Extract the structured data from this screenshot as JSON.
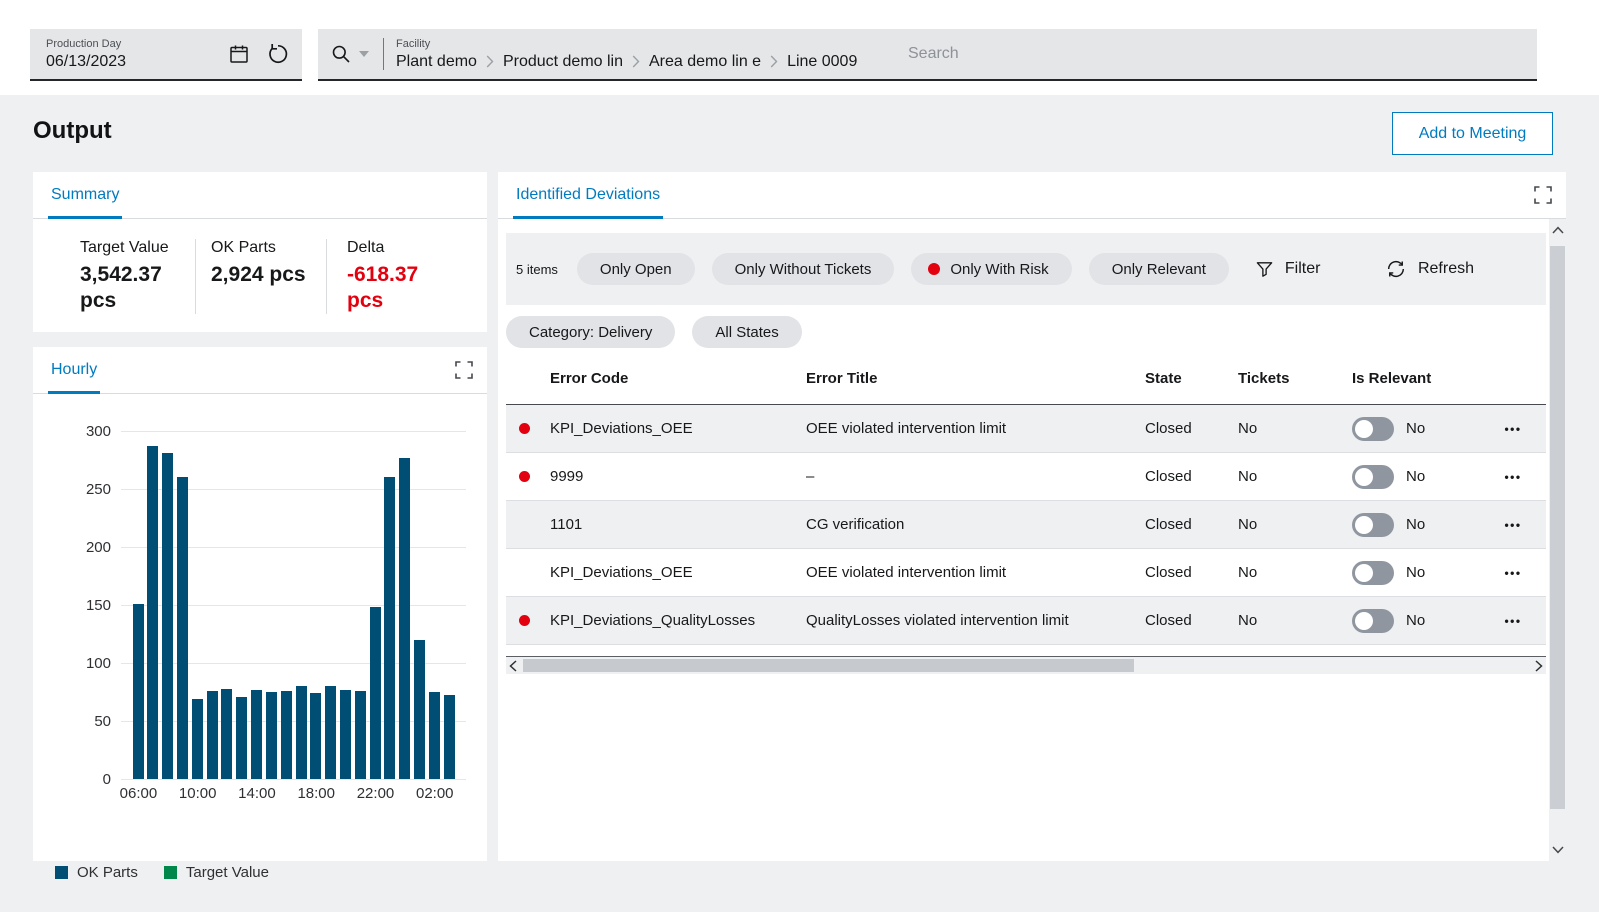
{
  "colors": {
    "accent_blue": "#007bc0",
    "bar_blue": "#004e73",
    "target_green": "#00884a",
    "alert_red": "#e3000f"
  },
  "topbar": {
    "production_day": {
      "label": "Production Day",
      "value": "06/13/2023"
    },
    "facility": {
      "label": "Facility",
      "breadcrumb": [
        "Plant demo",
        "Product demo lin",
        "Area demo lin e",
        "Line 0009"
      ],
      "search_placeholder": "Search"
    }
  },
  "page": {
    "title": "Output",
    "add_to_meeting_label": "Add to Meeting"
  },
  "summary": {
    "tab_label": "Summary",
    "stats": [
      {
        "label": "Target Value",
        "value": "3,542.37 pcs",
        "color": "dark"
      },
      {
        "label": "OK Parts",
        "value": "2,924 pcs",
        "color": "dark"
      },
      {
        "label": "Delta",
        "value": "-618.37 pcs",
        "color": "red"
      }
    ]
  },
  "hourly": {
    "tab_label": "Hourly",
    "legend": [
      {
        "label": "OK Parts",
        "color": "#004e73"
      },
      {
        "label": "Target Value",
        "color": "#00884a"
      }
    ]
  },
  "chart_data": {
    "type": "bar",
    "title": "Hourly",
    "x": [
      "06:00",
      "07:00",
      "08:00",
      "09:00",
      "10:00",
      "11:00",
      "12:00",
      "13:00",
      "14:00",
      "15:00",
      "16:00",
      "17:00",
      "18:00",
      "19:00",
      "20:00",
      "21:00",
      "22:00",
      "23:00",
      "00:00",
      "01:00",
      "02:00",
      "03:00"
    ],
    "series": [
      {
        "name": "OK Parts",
        "color": "#004e73",
        "values": [
          151,
          287,
          281,
          260,
          69,
          76,
          78,
          71,
          77,
          75,
          76,
          80,
          74,
          80,
          77,
          76,
          148,
          260,
          277,
          120,
          75,
          72
        ]
      },
      {
        "name": "Target Value",
        "color": "#00884a",
        "values": []
      }
    ],
    "ylim": [
      0,
      300
    ],
    "ytick_step": 50,
    "xticks_shown": [
      "06:00",
      "10:00",
      "14:00",
      "18:00",
      "22:00",
      "02:00"
    ],
    "grid": "horizontal",
    "legend_position": "bottom"
  },
  "deviations": {
    "tab_label": "Identified Deviations",
    "items_count": "5 items",
    "quick_filters": [
      {
        "label": "Only Open",
        "dot": false
      },
      {
        "label": "Only Without Tickets",
        "dot": false
      },
      {
        "label": "Only With Risk",
        "dot": true
      },
      {
        "label": "Only Relevant",
        "dot": false
      }
    ],
    "filter_label": "Filter",
    "refresh_label": "Refresh",
    "applied_filters": [
      "Category: Delivery",
      "All States"
    ],
    "columns": [
      "Error Code",
      "Error Title",
      "State",
      "Tickets",
      "Is Relevant"
    ],
    "rows": [
      {
        "risk": true,
        "error_code": "KPI_Deviations_OEE",
        "error_title": "OEE violated intervention limit",
        "state": "Closed",
        "tickets": "No",
        "is_relevant": "No"
      },
      {
        "risk": true,
        "error_code": "9999",
        "error_title": "–",
        "state": "Closed",
        "tickets": "No",
        "is_relevant": "No"
      },
      {
        "risk": false,
        "error_code": "1101",
        "error_title": "CG verification",
        "state": "Closed",
        "tickets": "No",
        "is_relevant": "No"
      },
      {
        "risk": false,
        "error_code": "KPI_Deviations_OEE",
        "error_title": "OEE violated intervention limit",
        "state": "Closed",
        "tickets": "No",
        "is_relevant": "No"
      },
      {
        "risk": true,
        "error_code": "KPI_Deviations_QualityLosses",
        "error_title": "QualityLosses violated intervention limit",
        "state": "Closed",
        "tickets": "No",
        "is_relevant": "No"
      }
    ]
  }
}
